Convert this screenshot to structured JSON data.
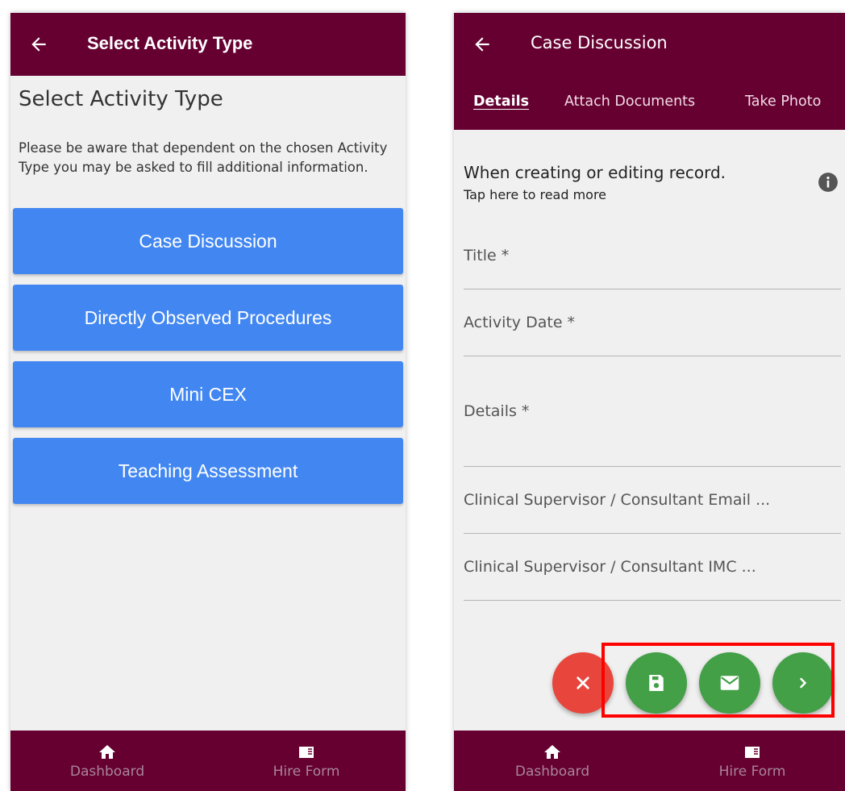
{
  "left_screen": {
    "appbar": {
      "title": "Select Activity Type"
    },
    "heading": "Select Activity Type",
    "notice": "Please be aware that dependent on the chosen Activity Type you may be asked to fill additional information.",
    "activity_types": [
      {
        "label": "Case Discussion"
      },
      {
        "label": "Directly Observed Procedures"
      },
      {
        "label": "Mini CEX"
      },
      {
        "label": "Teaching Assessment"
      }
    ],
    "bottom_nav": [
      {
        "label": "Dashboard",
        "icon": "home-icon"
      },
      {
        "label": "Hire Form",
        "icon": "hire-form-icon"
      }
    ]
  },
  "right_screen": {
    "appbar": {
      "title": "Case Discussion"
    },
    "tabs": [
      {
        "label": "Details",
        "active": true
      },
      {
        "label": "Attach Documents",
        "active": false
      },
      {
        "label": "Take Photo",
        "active": false
      }
    ],
    "info": {
      "title": "When creating or editing record.",
      "subtitle": "Tap here to read more",
      "icon": "info-icon"
    },
    "fields": [
      {
        "label": "Title *"
      },
      {
        "label": "Activity Date *"
      },
      {
        "label": "Details *"
      },
      {
        "label": "Clinical Supervisor / Consultant Email ..."
      },
      {
        "label": "Clinical Supervisor / Consultant IMC ..."
      }
    ],
    "actions": [
      {
        "name": "cancel",
        "icon": "close-icon",
        "color": "#e8463c"
      },
      {
        "name": "save",
        "icon": "save-icon",
        "color": "#43a047"
      },
      {
        "name": "email",
        "icon": "email-icon",
        "color": "#43a047"
      },
      {
        "name": "next",
        "icon": "chevron-right-icon",
        "color": "#43a047"
      }
    ],
    "bottom_nav": [
      {
        "label": "Dashboard",
        "icon": "home-icon"
      },
      {
        "label": "Hire Form",
        "icon": "hire-form-icon"
      }
    ]
  },
  "colors": {
    "appbar": "#650030",
    "primary_button": "#4287f1",
    "fab_green": "#43a047",
    "fab_red": "#e8463c",
    "highlight": "#ff0000"
  }
}
